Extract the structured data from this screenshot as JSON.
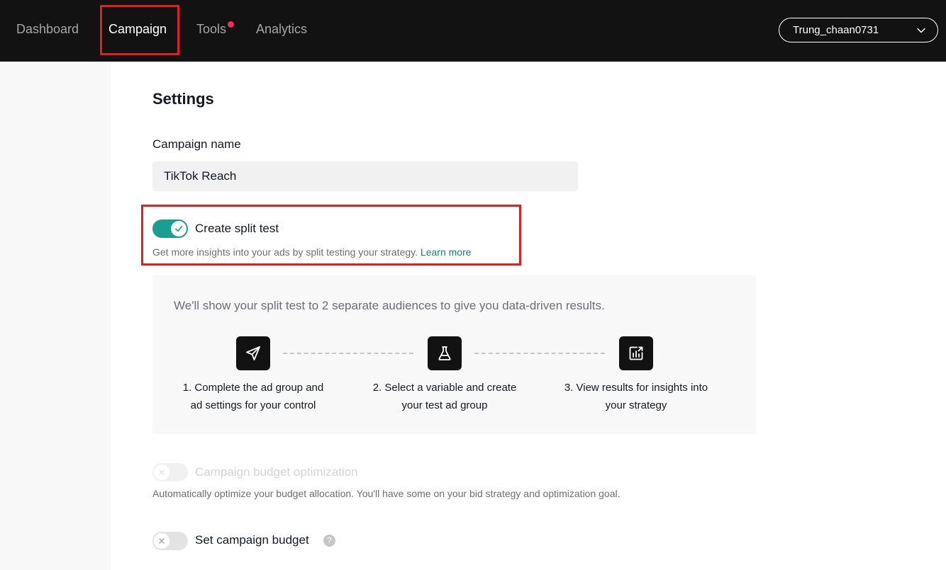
{
  "nav": {
    "items": [
      {
        "label": "Dashboard"
      },
      {
        "label": "Campaign"
      },
      {
        "label": "Tools"
      },
      {
        "label": "Analytics"
      }
    ],
    "account_name": "Trung_chaan0731"
  },
  "settings": {
    "title": "Settings",
    "campaign_name_label": "Campaign name",
    "campaign_name_value": "TikTok Reach",
    "split_test": {
      "label": "Create split test",
      "enabled": true,
      "description": "Get more insights into your ads by split testing your strategy.",
      "learn_more": "Learn more"
    },
    "info": {
      "text": "We'll show your split test to 2 separate audiences to give you data-driven results.",
      "steps": [
        {
          "icon": "send-icon",
          "line1": "1. Complete the ad group and",
          "line2": "ad settings for your control"
        },
        {
          "icon": "flask-icon",
          "line1": "2. Select a variable and create",
          "line2": "your test ad group"
        },
        {
          "icon": "chart-icon",
          "line1": "3. View results for insights into",
          "line2": "your strategy"
        }
      ]
    },
    "cbo": {
      "label": "Campaign budget optimization",
      "enabled": false,
      "disabled": true,
      "description": "Automatically optimize your budget allocation. You'll have some on your bid strategy and optimization goal."
    },
    "budget": {
      "label": "Set campaign budget",
      "enabled": false,
      "help": "?"
    }
  },
  "colors": {
    "nav_bg": "#121212",
    "toggle_on": "#1a9e8f",
    "link": "#1f7a72",
    "highlight": "#e02020",
    "notification_dot": "#fe2c55"
  }
}
